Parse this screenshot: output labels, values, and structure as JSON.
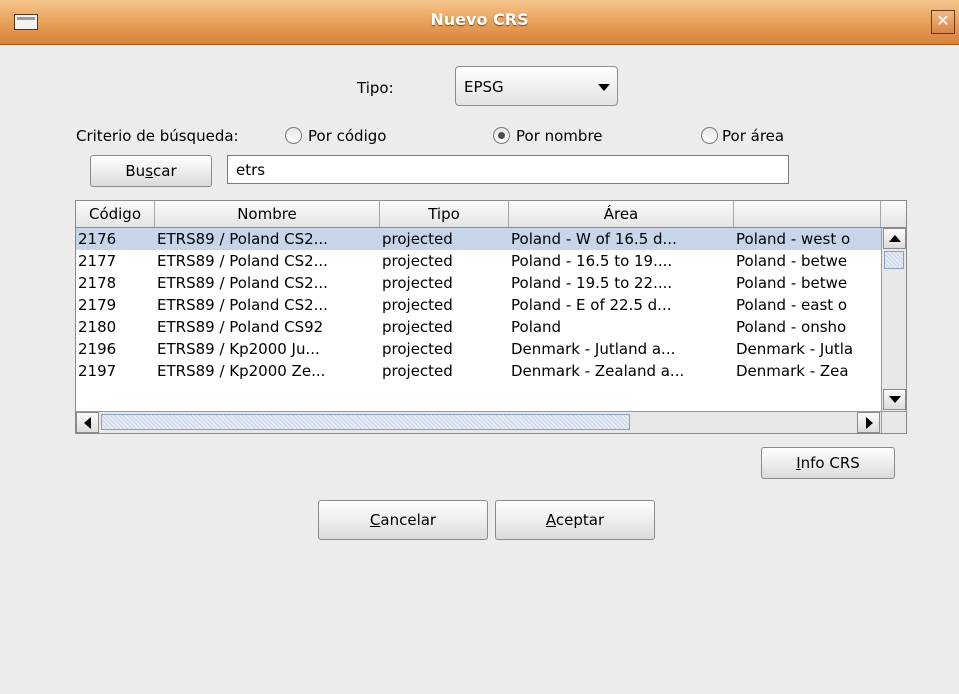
{
  "window": {
    "title": "Nuevo CRS"
  },
  "tipo": {
    "label": "Tipo:",
    "selected": "EPSG"
  },
  "criterio": {
    "label": "Criterio de búsqueda:",
    "options": [
      {
        "label": "Por código",
        "checked": false
      },
      {
        "label": "Por nombre",
        "checked": true
      },
      {
        "label": "Por área",
        "checked": false
      }
    ]
  },
  "search": {
    "button": {
      "pre": "Bu",
      "mnemonic": "s",
      "post": "car"
    },
    "value": "etrs"
  },
  "table": {
    "columns": [
      "Código",
      "Nombre",
      "Tipo",
      "Área",
      ""
    ],
    "rows": [
      [
        "2176",
        "ETRS89 / Poland CS2...",
        "projected",
        "Poland - W of 16.5 d...",
        "Poland - west o"
      ],
      [
        "2177",
        "ETRS89 / Poland CS2...",
        "projected",
        "Poland - 16.5 to 19....",
        "Poland - betwe"
      ],
      [
        "2178",
        "ETRS89 / Poland CS2...",
        "projected",
        "Poland - 19.5 to 22....",
        "Poland - betwe"
      ],
      [
        "2179",
        "ETRS89 / Poland CS2...",
        "projected",
        "Poland - E of 22.5 d...",
        "Poland - east o"
      ],
      [
        "2180",
        "ETRS89 / Poland CS92",
        "projected",
        "Poland",
        "Poland - onsho"
      ],
      [
        "2196",
        "ETRS89 / Kp2000 Ju...",
        "projected",
        "Denmark - Jutland a...",
        "Denmark - Jutla"
      ],
      [
        "2197",
        "ETRS89 / Kp2000 Ze...",
        "projected",
        "Denmark - Zealand a...",
        "Denmark - Zea"
      ]
    ],
    "selected_row": 0
  },
  "buttons": {
    "info": {
      "mnemonic": "I",
      "post": "nfo CRS"
    },
    "cancelar": {
      "mnemonic": "C",
      "post": "ancelar"
    },
    "aceptar": {
      "mnemonic": "A",
      "post": "ceptar"
    }
  },
  "colors": {
    "titlebar": "#e9a45d",
    "selection": "#c6d5e9",
    "background": "#ececec"
  },
  "icons": [
    "window-menu-icon",
    "close-icon",
    "dropdown-arrow-icon",
    "scroll-up-icon",
    "scroll-down-icon",
    "scroll-left-icon",
    "scroll-right-icon"
  ]
}
